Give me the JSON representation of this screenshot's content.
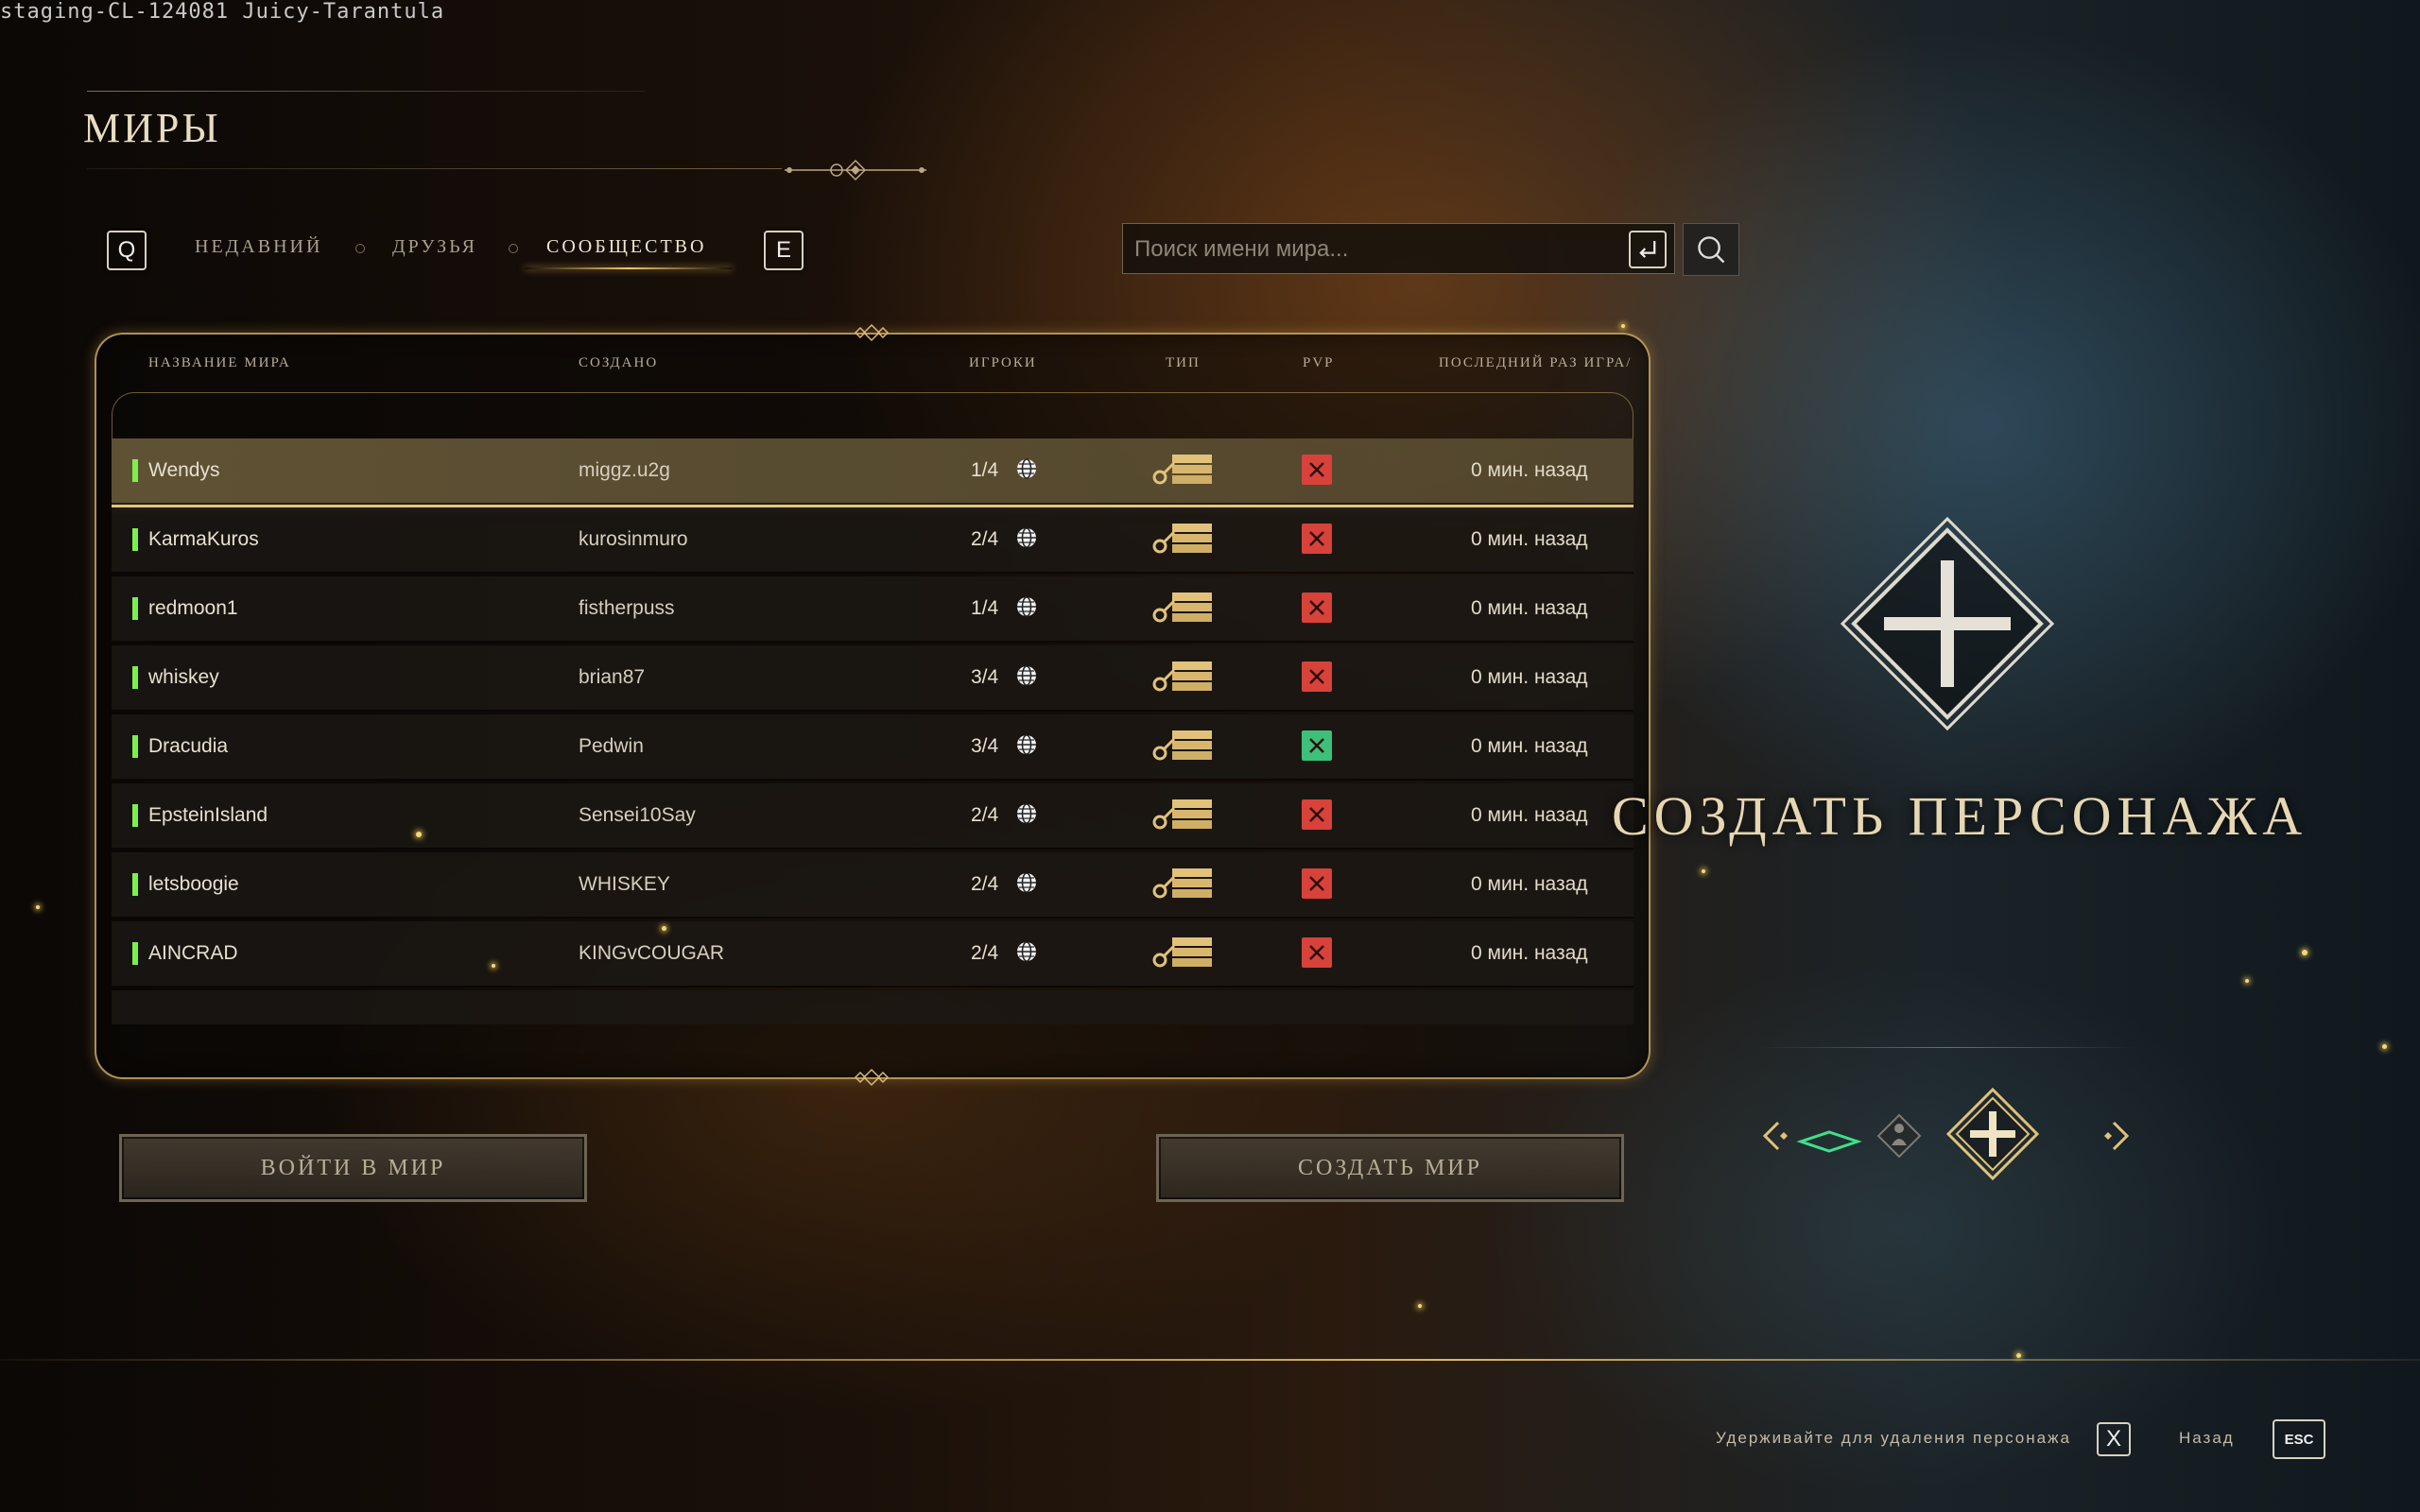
{
  "build_label": "staging-CL-124081 Juicy-Tarantula",
  "page_title": "МИРЫ",
  "tabs": {
    "prev_key": "Q",
    "next_key": "E",
    "items": [
      "НЕДАВНИЙ",
      "ДРУЗЬЯ",
      "СООБЩЕСТВО"
    ],
    "active": "СООБЩЕСТВО"
  },
  "search": {
    "placeholder": "Поиск имени мира...",
    "value": ""
  },
  "table": {
    "columns": [
      "НАЗВАНИЕ МИРА",
      "СОЗДАНО",
      "ИГРОКИ",
      "ТИП",
      "PVP",
      "ПОСЛЕДНИЙ РАЗ ИГРА/"
    ],
    "rows": [
      {
        "name": "Wendys",
        "owner": "miggz.u2g",
        "players": "1/4",
        "pvp": false,
        "last": "0 мин. назад",
        "selected": true
      },
      {
        "name": "KarmaKuros",
        "owner": "kurosinmuro",
        "players": "2/4",
        "pvp": false,
        "last": "0 мин. назад"
      },
      {
        "name": "redmoon1",
        "owner": "fistherpuss",
        "players": "1/4",
        "pvp": false,
        "last": "0 мин. назад"
      },
      {
        "name": "whiskey",
        "owner": "brian87",
        "players": "3/4",
        "pvp": false,
        "last": "0 мин. назад"
      },
      {
        "name": "Dracudia",
        "owner": "Pedwin",
        "players": "3/4",
        "pvp": true,
        "last": "0 мин. назад"
      },
      {
        "name": "EpsteinIsland",
        "owner": "Sensei10Say",
        "players": "2/4",
        "pvp": false,
        "last": "0 мин. назад"
      },
      {
        "name": "letsboogie",
        "owner": "WHISKEY",
        "players": "2/4",
        "pvp": false,
        "last": "0 мин. назад"
      },
      {
        "name": "AINCRAD",
        "owner": "KINGvCOUGAR",
        "players": "2/4",
        "pvp": false,
        "last": "0 мин. назад"
      }
    ]
  },
  "buttons": {
    "enter_world": "ВОЙТИ В МИР",
    "create_world": "СОЗДАТЬ МИР"
  },
  "character": {
    "create_label": "СОЗДАТЬ ПЕРСОНАЖА"
  },
  "footer": {
    "delete_hint": "Удерживайте для удаления персонажа",
    "delete_key": "X",
    "back_label": "Назад",
    "back_key": "ESC"
  },
  "colors": {
    "accent_gold": "#e2c27a",
    "status_online": "#7cf04a",
    "pvp_off": "#d8423a",
    "pvp_on": "#3dc07a"
  },
  "icons": [
    "search-icon",
    "enter-key-icon",
    "globe-icon",
    "server-key-icon",
    "pvp-cross-icon",
    "plus-diamond-icon",
    "chevron-left-icon",
    "chevron-right-icon",
    "character-silhouette-icon"
  ]
}
